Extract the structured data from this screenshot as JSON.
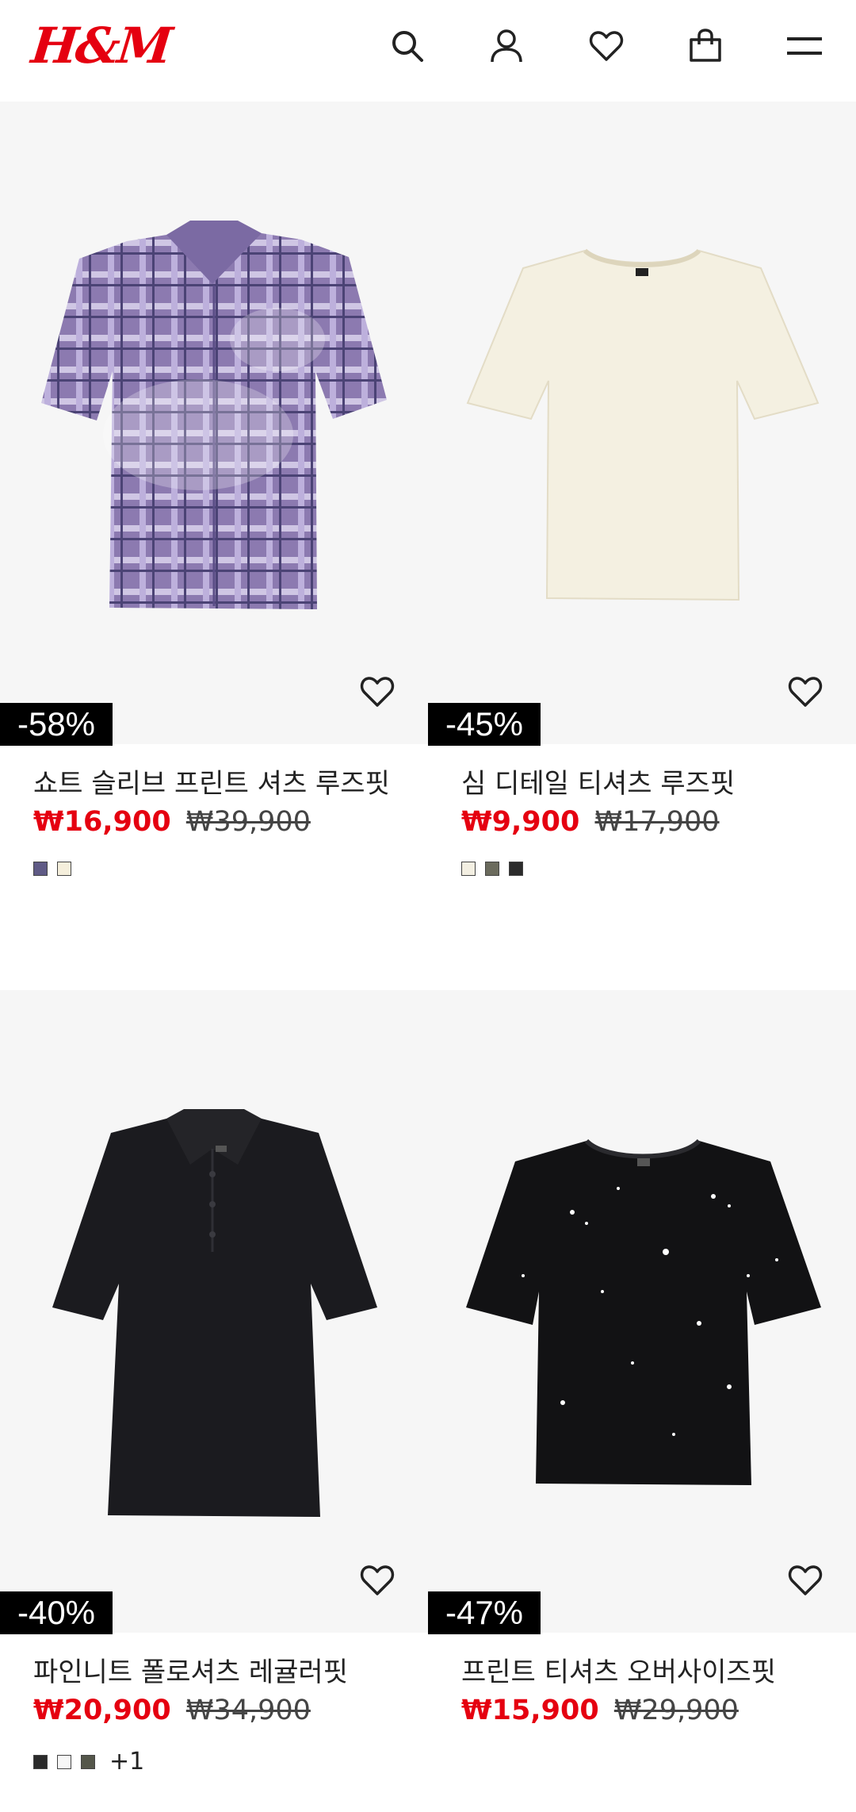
{
  "header": {
    "logo_text": "H&M",
    "icons": [
      "search-icon",
      "account-icon",
      "favorites-icon",
      "shopping-bag-icon",
      "menu-icon"
    ]
  },
  "products": [
    {
      "title": "쇼트 슬리브 프린트 셔츠 루즈핏",
      "sale_price": "₩16,900",
      "original_price": "₩39,900",
      "discount": "-58%",
      "swatches": [
        "#5f5a85",
        "#f5efdc"
      ],
      "more_colors": ""
    },
    {
      "title": "심 디테일 티셔츠 루즈핏",
      "sale_price": "₩9,900",
      "original_price": "₩17,900",
      "discount": "-45%",
      "swatches": [
        "#f3efe2",
        "#6b6b5d",
        "#2b2b2b"
      ],
      "more_colors": ""
    },
    {
      "title": "파인니트 폴로셔츠 레귤러핏",
      "sale_price": "₩20,900",
      "original_price": "₩34,900",
      "discount": "-40%",
      "swatches": [
        "#2a2a2a",
        "#f7f7f7",
        "#54564a"
      ],
      "more_colors": "+1"
    },
    {
      "title": "프린트 티셔츠 오버사이즈핏",
      "sale_price": "₩15,900",
      "original_price": "₩29,900",
      "discount": "-47%",
      "swatches": [],
      "more_colors": ""
    }
  ],
  "colors": {
    "brand": "#e50010",
    "badge_bg": "#000000",
    "image_bg": "#f6f6f6"
  }
}
